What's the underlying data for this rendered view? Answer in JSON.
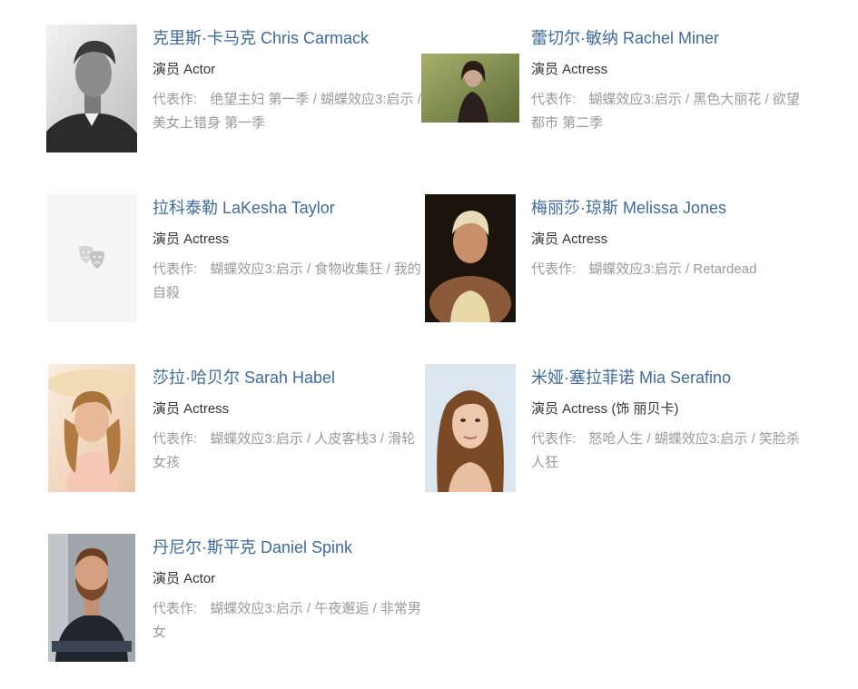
{
  "cast": [
    {
      "name": "克里斯·卡马克 Chris Carmack",
      "role": "演员 Actor",
      "works_label": "代表作:",
      "works": [
        "绝望主妇 第一季",
        "蝴蝶效应3:启示",
        "美女上错身 第一季"
      ]
    },
    {
      "name": "蕾切尔·敏纳 Rachel Miner",
      "role": "演员 Actress",
      "works_label": "代表作:",
      "works": [
        "蝴蝶效应3:启示",
        "黑色大丽花",
        "欲望都市 第二季"
      ]
    },
    {
      "name": "拉科泰勒 LaKesha Taylor",
      "role": "演员 Actress",
      "works_label": "代表作:",
      "works": [
        "蝴蝶效应3:启示",
        "食物收集狂",
        "我的自殺"
      ]
    },
    {
      "name": "梅丽莎·琼斯 Melissa Jones",
      "role": "演员 Actress",
      "works_label": "代表作:",
      "works": [
        "蝴蝶效应3:启示",
        "Retardead"
      ]
    },
    {
      "name": "莎拉·哈贝尔 Sarah Habel",
      "role": "演员 Actress",
      "works_label": "代表作:",
      "works": [
        "蝴蝶效应3:启示",
        "人皮客栈3",
        "滑轮女孩"
      ]
    },
    {
      "name": "米娅·塞拉菲诺 Mia Serafino",
      "role": "演员 Actress (饰 丽贝卡)",
      "works_label": "代表作:",
      "works": [
        "怒呛人生",
        "蝴蝶效应3:启示",
        "笑脸杀人狂"
      ]
    },
    {
      "name": "丹尼尔·斯平克 Daniel Spink",
      "role": "演员 Actor",
      "works_label": "代表作:",
      "works": [
        "蝴蝶效应3:启示",
        "午夜邂逅",
        "非常男女"
      ]
    }
  ],
  "colors": {
    "name_link": "#3e6a9c",
    "role_text": "#333333",
    "works_text": "#9a9a9a",
    "placeholder_bg": "#f5f5f5"
  },
  "icons": {
    "placeholder": "theater-masks-icon"
  }
}
